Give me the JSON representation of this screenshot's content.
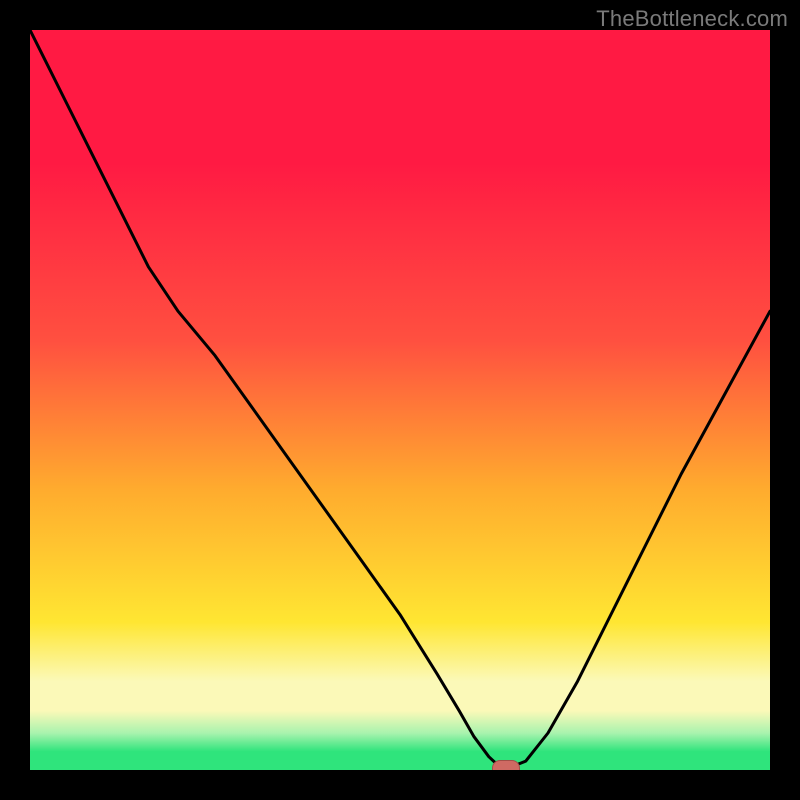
{
  "watermark": {
    "text": "TheBottleneck.com"
  },
  "colors": {
    "black": "#000000",
    "curve": "#000000",
    "marker_fill": "#cf6a63",
    "marker_stroke": "#a05048",
    "grad_top": "#ff1a43",
    "grad_upper": "#ff5040",
    "grad_orange": "#ffab2e",
    "grad_yellow": "#ffe632",
    "grad_pale": "#fbf9b8",
    "grad_mint": "#a9f3ae",
    "grad_green": "#2fe47c"
  },
  "chart_data": {
    "type": "line",
    "title": "",
    "xlabel": "",
    "ylabel": "",
    "xlim": [
      0,
      100
    ],
    "ylim": [
      0,
      100
    ],
    "x": [
      0,
      2,
      5,
      8,
      12,
      16,
      20,
      25,
      30,
      35,
      40,
      45,
      50,
      55,
      58,
      60,
      62,
      63.5,
      65,
      67,
      70,
      74,
      78,
      83,
      88,
      94,
      100
    ],
    "y": [
      100,
      96,
      90,
      84,
      76,
      68,
      62,
      56,
      49,
      42,
      35,
      28,
      21,
      13,
      8,
      4.5,
      1.8,
      0.4,
      0.4,
      1.2,
      5,
      12,
      20,
      30,
      40,
      51,
      62
    ],
    "marker": {
      "x": 64.3,
      "y": 0.2
    },
    "gradient_stops_pct": [
      0,
      18,
      42,
      62,
      80,
      88,
      92,
      95,
      97.5,
      100
    ]
  }
}
